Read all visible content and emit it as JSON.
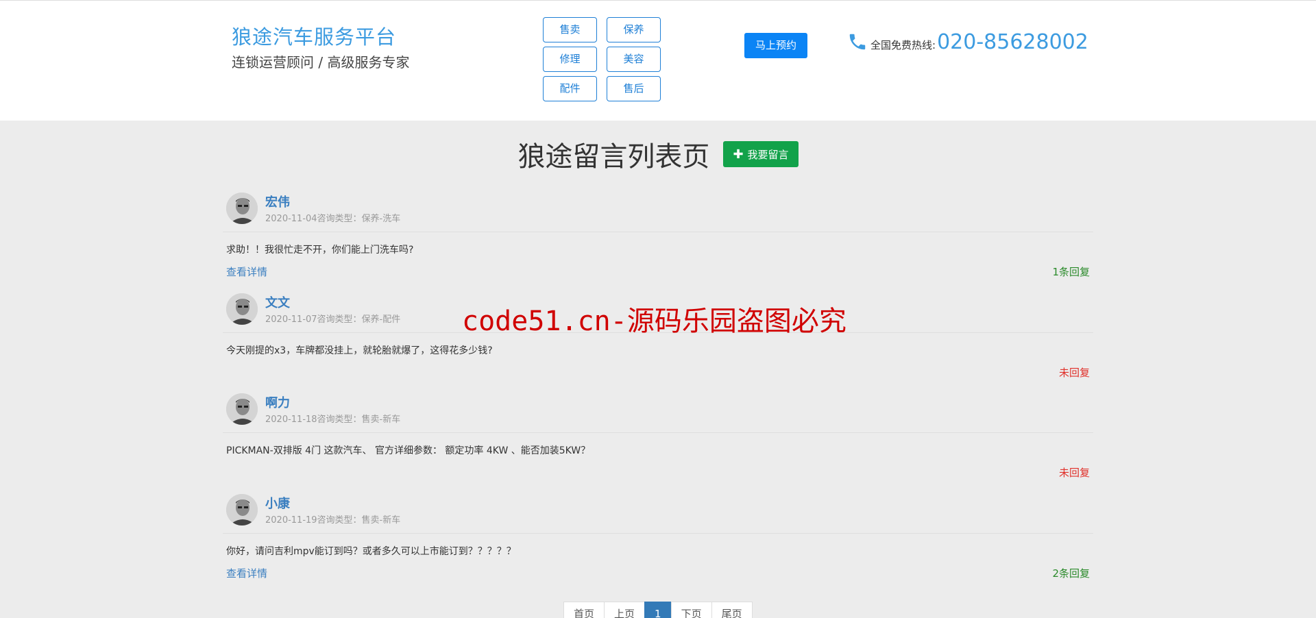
{
  "header": {
    "brand_title": "狼途汽车服务平台",
    "brand_subtitle": "连锁运营顾问 / 高级服务专家",
    "services": [
      "售卖",
      "保养",
      "修理",
      "美容",
      "配件",
      "售后"
    ],
    "book_button": "马上预约",
    "hotline_label": "全国免费热线:",
    "hotline_number": "020-85628002"
  },
  "page": {
    "title": "狼途留言列表页",
    "post_button": "我要留言"
  },
  "messages": [
    {
      "author": "宏伟",
      "meta": "2020-11-04咨询类型：保养-洗车",
      "content": "求助！！我很忙走不开，你们能上门洗车吗?",
      "detail": "查看详情",
      "reply": "1条回复"
    },
    {
      "author": "文文",
      "meta": "2020-11-07咨询类型：保养-配件",
      "content": "今天刚提的x3，车牌都没挂上，就轮胎就爆了，这得花多少钱?",
      "detail": "",
      "reply": "未回复"
    },
    {
      "author": "啊力",
      "meta": "2020-11-18咨询类型：售卖-新车",
      "content": "PICKMAN-双排版 4门 这款汽车、 官方详细参数： 额定功率 4KW 、能否加装5KW？",
      "detail": "",
      "reply": "未回复"
    },
    {
      "author": "小康",
      "meta": "2020-11-19咨询类型：售卖-新车",
      "content": "你好，请问吉利mpv能订到吗？或者多久可以上市能订到？？？？？",
      "detail": "查看详情",
      "reply": "2条回复"
    }
  ],
  "watermark": "code51.cn-源码乐园盗图必究",
  "pagination": [
    "首页",
    "上页",
    "1",
    "下页",
    "尾页"
  ],
  "colors": {
    "brand": "#3c9be0",
    "primary": "#0b84f5",
    "success": "#12a24a",
    "replied": "#2a8a2a",
    "unreplied": "#e0302a"
  }
}
